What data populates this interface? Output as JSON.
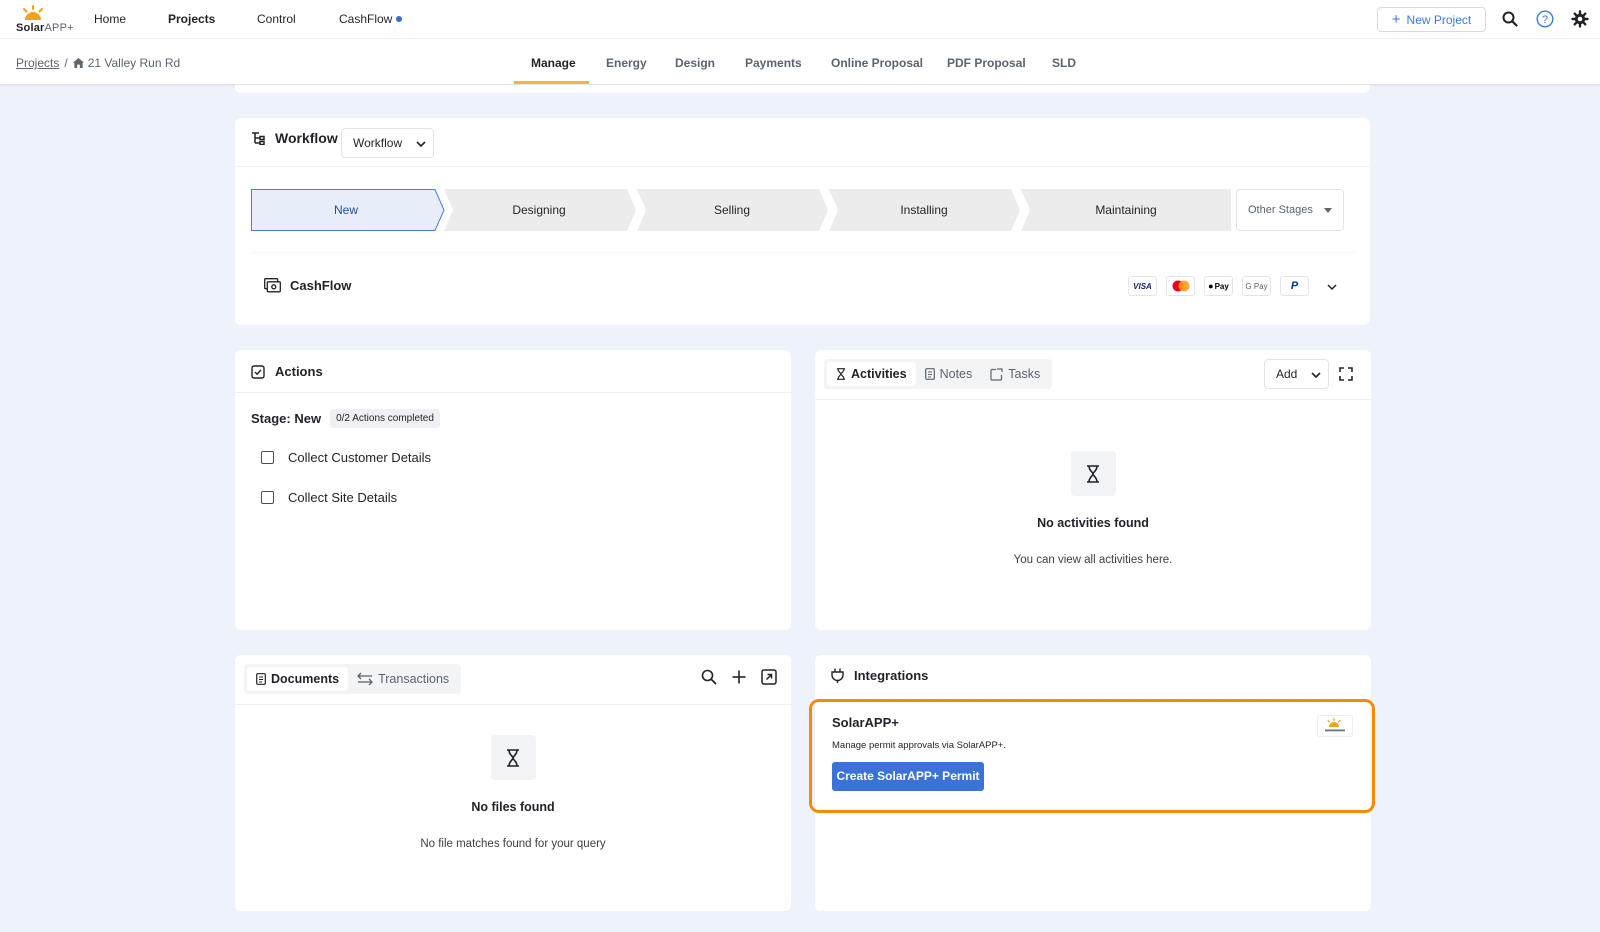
{
  "brand": {
    "name_bold": "Solar",
    "name_rest": "APP+",
    "accent": "#f2a21b"
  },
  "nav": {
    "home": "Home",
    "projects": "Projects",
    "control": "Control",
    "cashflow": "CashFlow"
  },
  "header": {
    "new_project": "New Project",
    "icons": [
      "search-icon",
      "help-icon",
      "gear-icon"
    ]
  },
  "breadcrumb": {
    "projects": "Projects",
    "address": "21 Valley Run Rd"
  },
  "tabs": [
    "Manage",
    "Energy",
    "Design",
    "Payments",
    "Online Proposal",
    "PDF Proposal",
    "SLD"
  ],
  "active_tab": "Manage",
  "workflow": {
    "title": "Workflow",
    "select_value": "Workflow",
    "stages": [
      "New",
      "Designing",
      "Selling",
      "Installing",
      "Maintaining"
    ],
    "active_stage": "New",
    "other_stages": "Other Stages"
  },
  "cashflow": {
    "title": "CashFlow",
    "payment_methods": [
      "VISA",
      "Mastercard",
      "Pay",
      "G Pay",
      "PayPal"
    ]
  },
  "actions": {
    "title": "Actions",
    "stage_label": "Stage: New",
    "badge": "0/2 Actions completed",
    "items": [
      "Collect Customer Details",
      "Collect Site Details"
    ]
  },
  "activities": {
    "tabs": [
      "Activities",
      "Notes",
      "Tasks"
    ],
    "add_label": "Add",
    "empty_title": "No activities found",
    "empty_sub": "You can view all activities here."
  },
  "documents": {
    "tabs": [
      "Documents",
      "Transactions"
    ],
    "empty_title": "No files found",
    "empty_sub": "No file matches found for your query"
  },
  "integrations": {
    "title": "Integrations",
    "name": "SolarAPP+",
    "description": "Manage permit approvals via SolarAPP+.",
    "button": "Create SolarAPP+ Permit",
    "highlight": "#f58a07",
    "button_color": "#3a72d8"
  }
}
